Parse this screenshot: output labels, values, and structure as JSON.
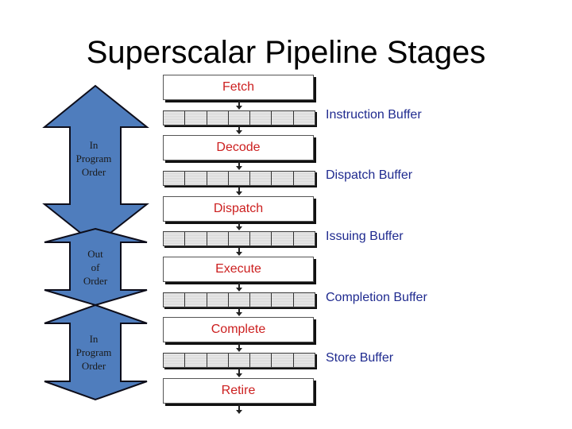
{
  "title": "Superscalar Pipeline Stages",
  "colors": {
    "arrow_fill": "#4f7dbd",
    "arrow_stroke": "#0d0d1a",
    "stage_text": "#cc1f1f",
    "buffer_label": "#1f2a8f"
  },
  "order_arrows": [
    {
      "label_lines": [
        "In",
        "Program",
        "Order"
      ]
    },
    {
      "label_lines": [
        "Out",
        "of",
        "Order"
      ]
    },
    {
      "label_lines": [
        "In",
        "Program",
        "Order"
      ]
    }
  ],
  "stages": [
    "Fetch",
    "Decode",
    "Dispatch",
    "Execute",
    "Complete",
    "Retire"
  ],
  "buffers": [
    "Instruction Buffer",
    "Dispatch Buffer",
    "Issuing Buffer",
    "Completion Buffer",
    "Store Buffer"
  ]
}
